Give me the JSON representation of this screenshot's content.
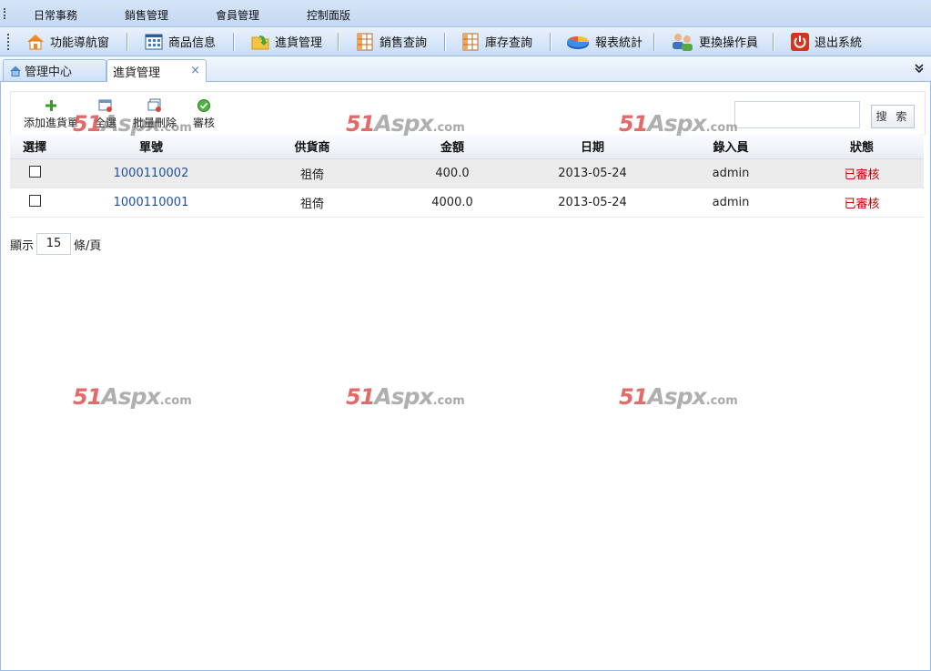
{
  "menu": [
    "日常事務",
    "銷售管理",
    "會員管理",
    "控制面版"
  ],
  "toolbar": [
    {
      "label": "功能導航窗",
      "icon": "home-icon"
    },
    {
      "label": "商品信息",
      "icon": "grid-window-icon"
    },
    {
      "label": "進貨管理",
      "icon": "folder-arrow-icon"
    },
    {
      "label": "銷售查詢",
      "icon": "table-icon"
    },
    {
      "label": "庫存查詢",
      "icon": "table-icon"
    },
    {
      "label": "報表統計",
      "icon": "pie-chart-icon"
    },
    {
      "label": "更換操作員",
      "icon": "users-icon"
    },
    {
      "label": "退出系統",
      "icon": "power-icon"
    }
  ],
  "tabs": [
    {
      "label": "管理中心",
      "icon": "house-icon"
    },
    {
      "label": "進貨管理",
      "close": "×"
    }
  ],
  "actions": [
    "添加進貨單",
    "全選",
    "批量刪除",
    "審核"
  ],
  "search": {
    "button": "搜 索",
    "value": ""
  },
  "table": {
    "headers": [
      "選擇",
      "單號",
      "供貨商",
      "金額",
      "日期",
      "錄入員",
      "狀態"
    ],
    "rows": [
      {
        "order_no": "1000110002",
        "supplier": "祖倚",
        "amount": "400.0",
        "date": "2013-05-24",
        "clerk": "admin",
        "status": "已審核"
      },
      {
        "order_no": "1000110001",
        "supplier": "祖倚",
        "amount": "4000.0",
        "date": "2013-05-24",
        "clerk": "admin",
        "status": "已審核"
      }
    ]
  },
  "pager": {
    "prefix": "顯示",
    "page_size": "15",
    "suffix": "條/頁"
  },
  "watermark": {
    "num": "51",
    "brand": "Aspx",
    "tld": ".com"
  },
  "colors": {
    "status_approved": "#c00000",
    "link": "#1f4ea8",
    "accent": "#99bbe8"
  }
}
